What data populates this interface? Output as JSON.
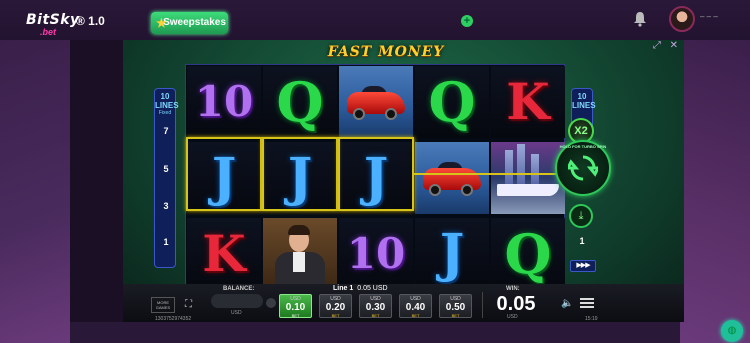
{
  "site": {
    "logo_text": "BitSky",
    "logo_sub": ".bet",
    "version": "® 1.0",
    "sweepstakes_label": "Sweepstakes",
    "user_menu_text": "– – –"
  },
  "game": {
    "title": "FAST MONEY",
    "lines_left": {
      "count": "10",
      "label": "LINES",
      "sub": "Fixed",
      "numbers": [
        "7",
        "5",
        "3",
        "1"
      ]
    },
    "lines_right": {
      "count": "10",
      "label": "LINES",
      "numbers": [
        "1"
      ]
    },
    "reels": [
      [
        "10",
        "J",
        "K"
      ],
      [
        "Q",
        "J",
        "man"
      ],
      [
        "car",
        "J",
        "10"
      ],
      [
        "Q",
        "car",
        "J"
      ],
      [
        "K",
        "yacht",
        "Q"
      ]
    ],
    "winning_line": "Line 1",
    "multiplier_label": "X2",
    "spin_hint": "HOLD FOR TURBO SPIN",
    "autoplay_label": "▶▶▶"
  },
  "bar": {
    "more_games": "MORE GAMES",
    "balance_label": "BALANCE:",
    "balance_unit": "USD",
    "line_label": "Line 1",
    "line_value": "0.05 USD",
    "bets": [
      {
        "unit": "USD",
        "value": "0.10",
        "tag": "BET",
        "active": true
      },
      {
        "unit": "USD",
        "value": "0.20",
        "tag": "BET",
        "active": false
      },
      {
        "unit": "USD",
        "value": "0.30",
        "tag": "BET",
        "active": false
      },
      {
        "unit": "USD",
        "value": "0.40",
        "tag": "BET",
        "active": false
      },
      {
        "unit": "USD",
        "value": "0.50",
        "tag": "BET",
        "active": false
      }
    ],
    "win_label": "WIN:",
    "win_value": "0.05",
    "win_unit": "USD"
  },
  "status": {
    "session_id": "1303752974352",
    "clock": "15:19"
  },
  "colors": {
    "accent_green": "#2ecf62",
    "title_gold": "#ffcf2e",
    "win_frame": "#d6c41a"
  }
}
